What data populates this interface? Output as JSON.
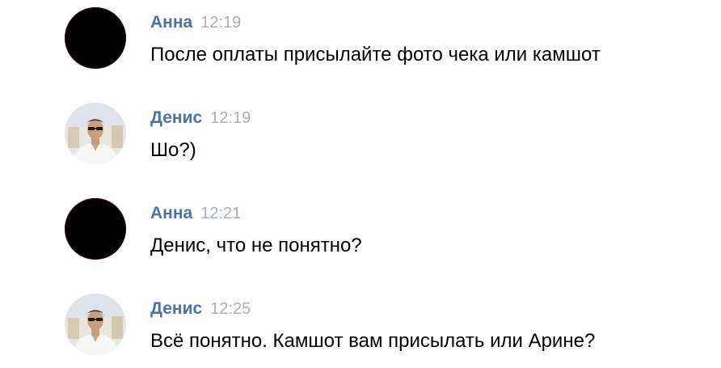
{
  "messages": [
    {
      "author": "Анна",
      "time": "12:19",
      "text": "После оплаты присылайте фото чека или камшот",
      "avatar": "dark-avatar"
    },
    {
      "author": "Денис",
      "time": "12:19",
      "text": "Шо?)",
      "avatar": "photo-avatar"
    },
    {
      "author": "Анна",
      "time": "12:21",
      "text": "Денис, что не понятно?",
      "avatar": "dark-avatar"
    },
    {
      "author": "Денис",
      "time": "12:25",
      "text": "Всё понятно. Камшот вам присылать или Арине?",
      "avatar": "photo-avatar"
    }
  ],
  "colors": {
    "author_name": "#4a73a6",
    "timestamp": "#a9b0b8",
    "message_text": "#000000",
    "background": "#ffffff"
  }
}
